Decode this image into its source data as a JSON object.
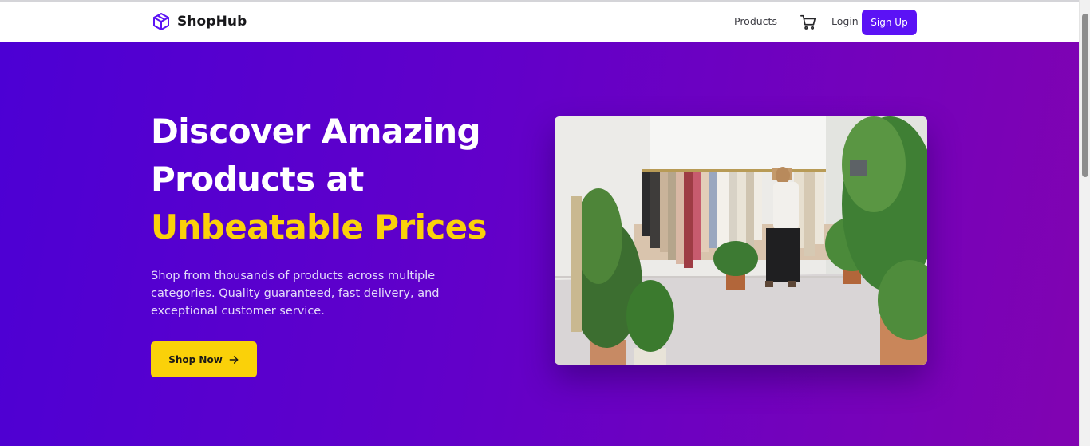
{
  "brand": {
    "name": "ShopHub",
    "icon": "box-icon",
    "color": "#5b12f5"
  },
  "nav": {
    "products_label": "Products",
    "cart_icon": "cart-icon",
    "login_label": "Login",
    "signup_label": "Sign Up"
  },
  "hero": {
    "title_line1": "Discover Amazing",
    "title_line2": "Products at",
    "title_accent": "Unbeatable Prices",
    "description_line1": "Shop from thousands of products across multiple",
    "description_line2": "categories. Quality guaranteed, fast delivery, and",
    "description_line3": "exceptional customer service.",
    "cta_label": "Shop Now",
    "cta_icon": "arrow-right-icon",
    "image_icon": "clothing-store-photo",
    "gradient_start": "#4c00d4",
    "gradient_end": "#8103b1",
    "accent_color": "#fbd10a"
  }
}
